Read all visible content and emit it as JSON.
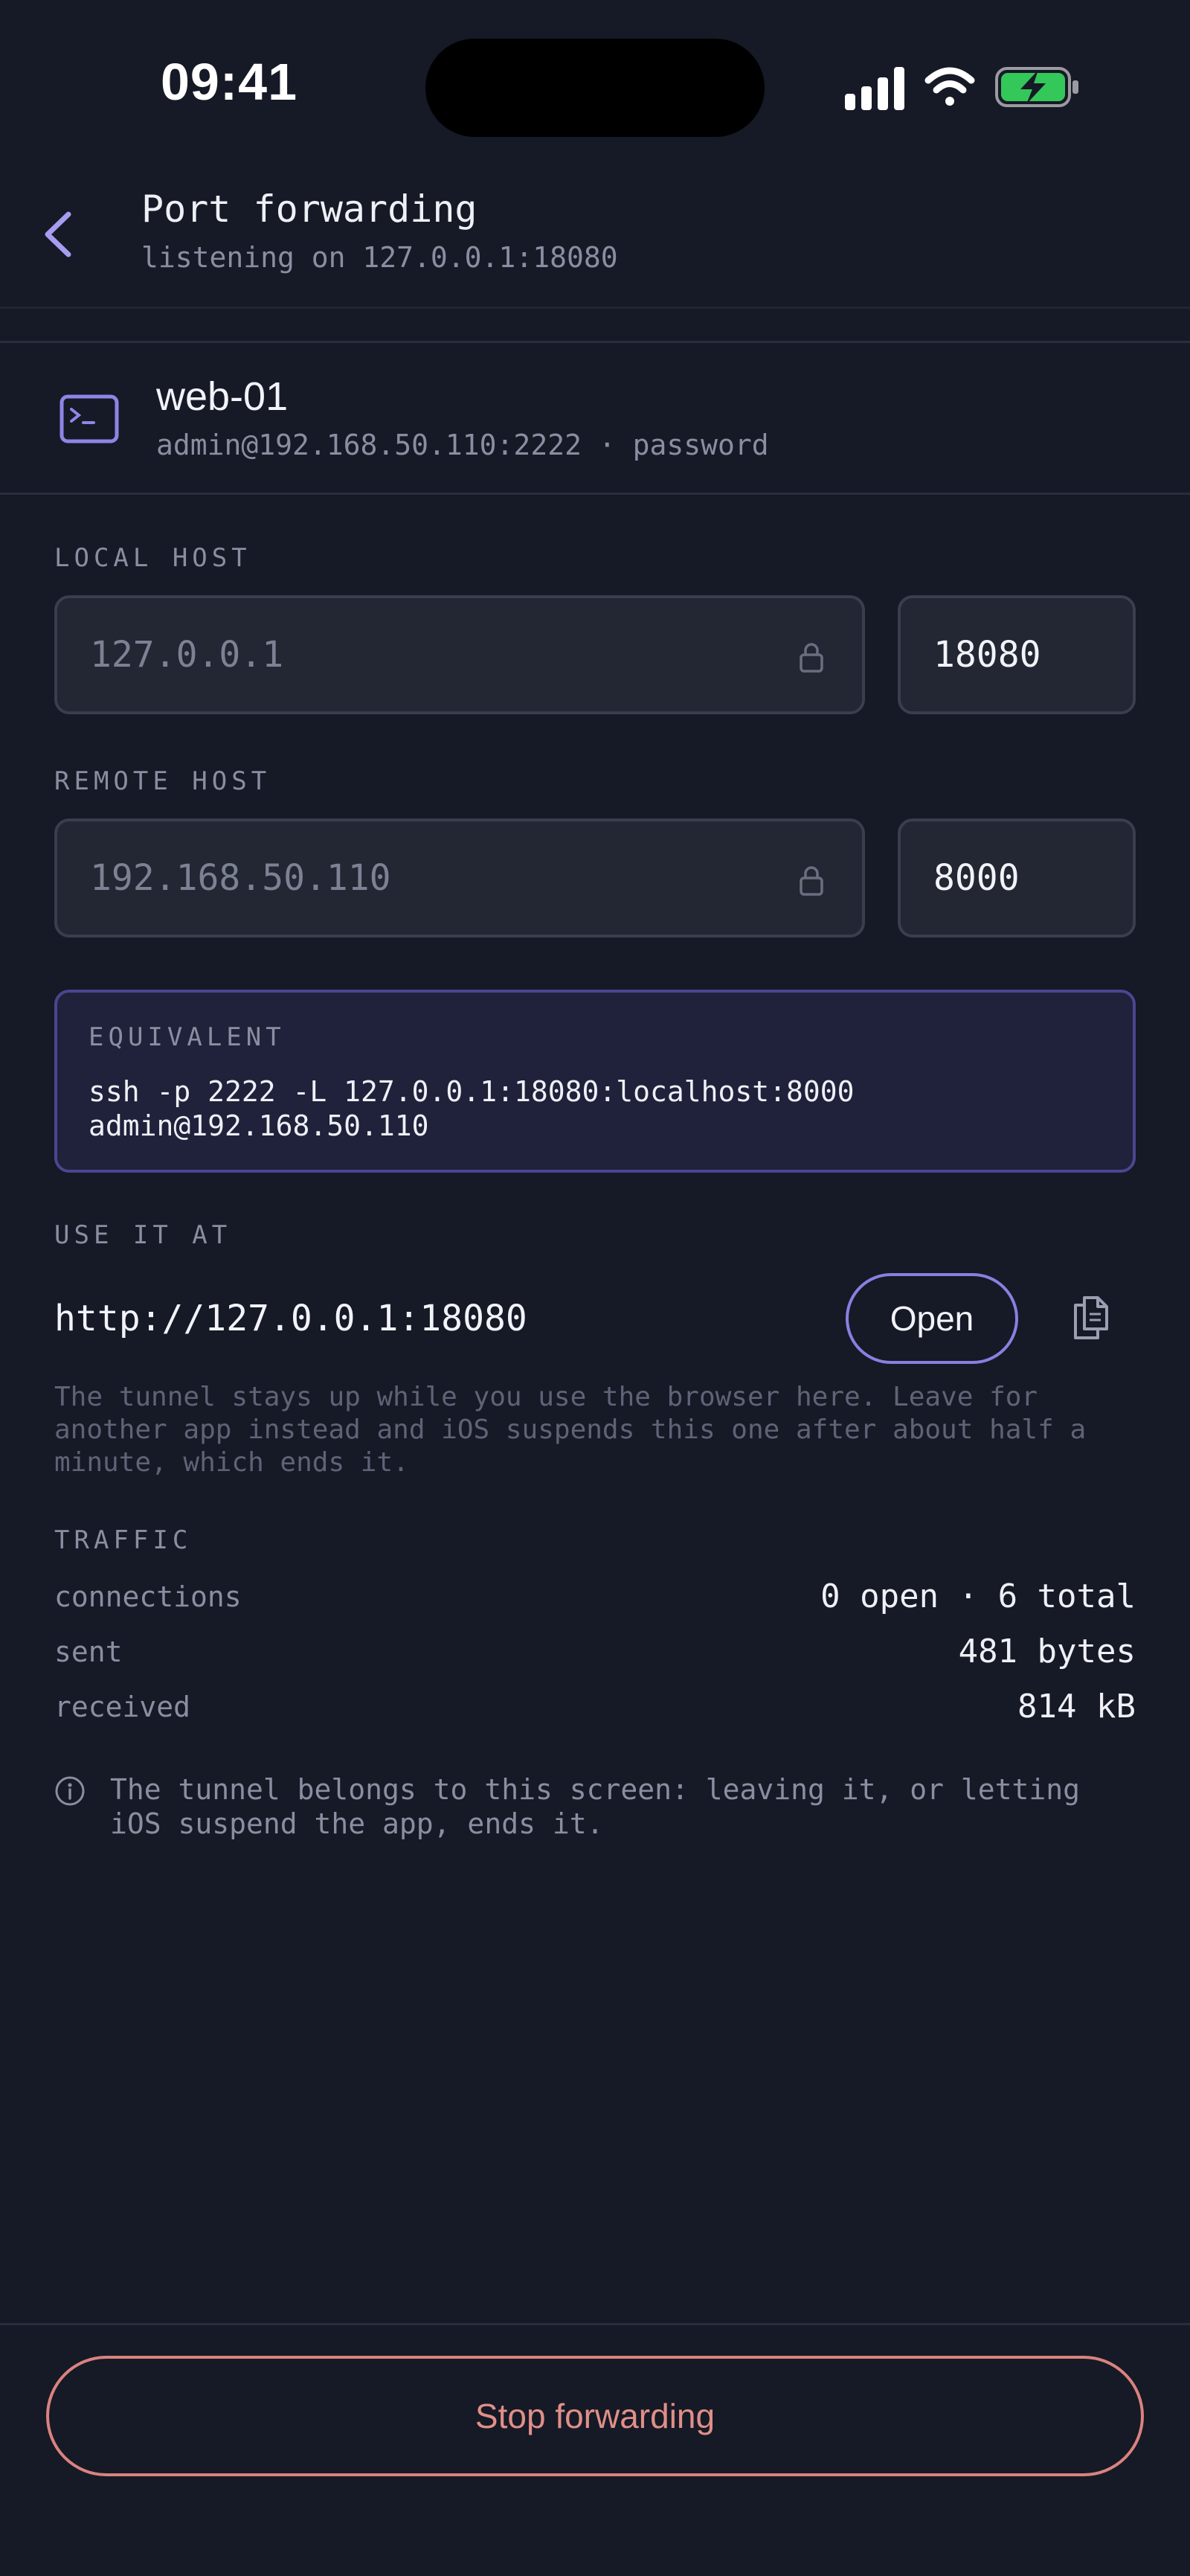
{
  "status_bar": {
    "time": "09:41"
  },
  "header": {
    "title": "Port forwarding",
    "subtitle": "listening on 127.0.0.1:18080"
  },
  "host": {
    "name": "web-01",
    "meta": "admin@192.168.50.110:2222 · password",
    "icon": "terminal-icon"
  },
  "local": {
    "label": "LOCAL HOST",
    "host": "127.0.0.1",
    "port": "18080"
  },
  "remote": {
    "label": "REMOTE HOST",
    "host": "192.168.50.110",
    "port": "8000"
  },
  "equivalent": {
    "label": "EQUIVALENT",
    "command": "ssh -p 2222 -L 127.0.0.1:18080:localhost:8000\nadmin@192.168.50.110"
  },
  "use_it_at": {
    "label": "USE IT AT",
    "url": "http://127.0.0.1:18080",
    "open_label": "Open",
    "note": "The tunnel stays up while you use the browser here. Leave for another app instead and iOS suspends this one after about half a minute, which ends it."
  },
  "traffic": {
    "label": "TRAFFIC",
    "rows": [
      {
        "key": "connections",
        "value": "0 open · 6 total"
      },
      {
        "key": "sent",
        "value": "481 bytes"
      },
      {
        "key": "received",
        "value": "814 kB"
      }
    ]
  },
  "info": "The tunnel belongs to this screen: leaving it, or letting iOS suspend the app, ends it.",
  "stop_label": "Stop forwarding",
  "colors": {
    "background": "#161926",
    "accent": "#8a7fe0",
    "danger": "#d9837e",
    "battery": "#34c759"
  }
}
